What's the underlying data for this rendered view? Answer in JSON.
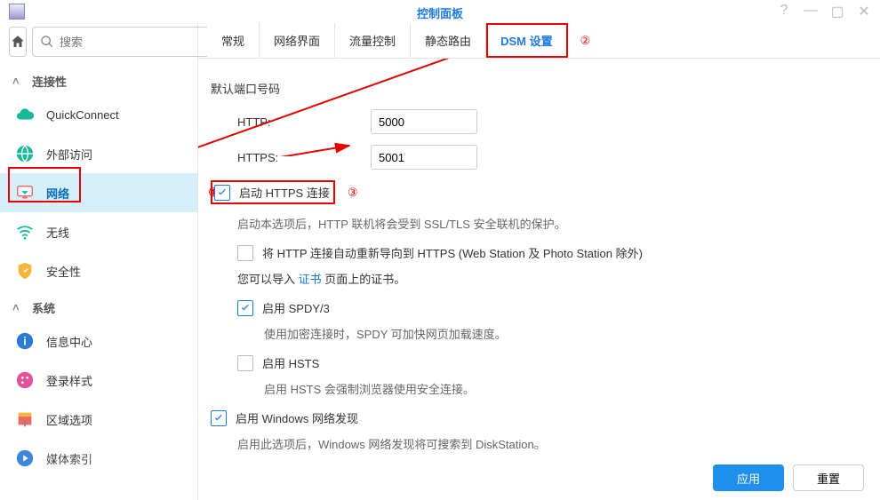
{
  "title": "控制面板",
  "search": {
    "placeholder": "搜索"
  },
  "sidebar": {
    "groups": [
      {
        "label": "连接性"
      },
      {
        "label": "系统"
      }
    ],
    "items": [
      {
        "label": "QuickConnect"
      },
      {
        "label": "外部访问"
      },
      {
        "label": "网络"
      },
      {
        "label": "无线"
      },
      {
        "label": "安全性"
      },
      {
        "label": "信息中心"
      },
      {
        "label": "登录样式"
      },
      {
        "label": "区域选项"
      },
      {
        "label": "媒体索引"
      }
    ]
  },
  "tabs": [
    {
      "label": "常规"
    },
    {
      "label": "网络界面"
    },
    {
      "label": "流量控制"
    },
    {
      "label": "静态路由"
    },
    {
      "label": "DSM 设置"
    }
  ],
  "markers": {
    "m1": "①",
    "m2": "②",
    "m3": "③"
  },
  "form": {
    "section_title": "默认端口号码",
    "http_label": "HTTP:",
    "http_value": "5000",
    "https_label": "HTTPS:",
    "https_value": "5001",
    "enable_https": "启动 HTTPS 连接",
    "https_desc": "启动本选项后，HTTP 联机将会受到 SSL/TLS 安全联机的保护。",
    "redirect_label": "将 HTTP 连接自动重新导向到 HTTPS (Web Station 及 Photo Station 除外)",
    "import_cert_prefix": "您可以导入 ",
    "import_cert_link": "证书",
    "import_cert_suffix": " 页面上的证书。",
    "spdy_label": "启用 SPDY/3",
    "spdy_desc": "使用加密连接时，SPDY 可加快网页加载速度。",
    "hsts_label": "启用 HSTS",
    "hsts_desc": "启用 HSTS 会强制浏览器使用安全连接。",
    "wnd_label": "启用 Windows 网络发现",
    "wnd_desc": "启用此选项后，Windows 网络发现将可搜索到 DiskStation。"
  },
  "buttons": {
    "apply": "应用",
    "reset": "重置"
  }
}
